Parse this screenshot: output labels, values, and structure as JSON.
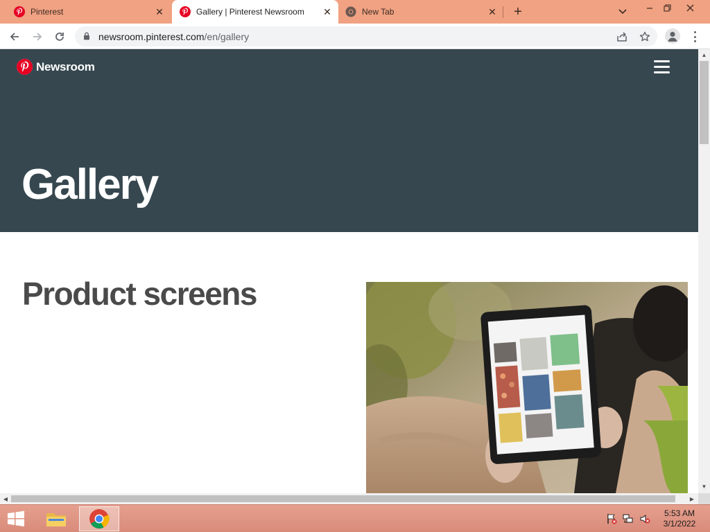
{
  "browser": {
    "tabs": [
      {
        "title": "Pinterest",
        "active": false,
        "favicon": "pinterest-icon"
      },
      {
        "title": "Gallery | Pinterest Newsroom",
        "active": true,
        "favicon": "pinterest-icon"
      },
      {
        "title": "New Tab",
        "active": false,
        "favicon": "chrome-icon"
      }
    ],
    "new_tab_symbol": "+",
    "url": {
      "host": "newsroom.pinterest.com",
      "path": "/en/gallery"
    }
  },
  "page": {
    "logo_text": "Newsroom",
    "hero_title": "Gallery",
    "section_title": "Product screens",
    "colors": {
      "hero_background": "#36474f",
      "pinterest_red": "#e60023",
      "section_text": "#4a4a4a"
    }
  },
  "taskbar": {
    "clock_time": "5:53 AM",
    "clock_date": "3/1/2022",
    "apps": [
      "file-explorer-icon",
      "chrome-icon"
    ]
  }
}
